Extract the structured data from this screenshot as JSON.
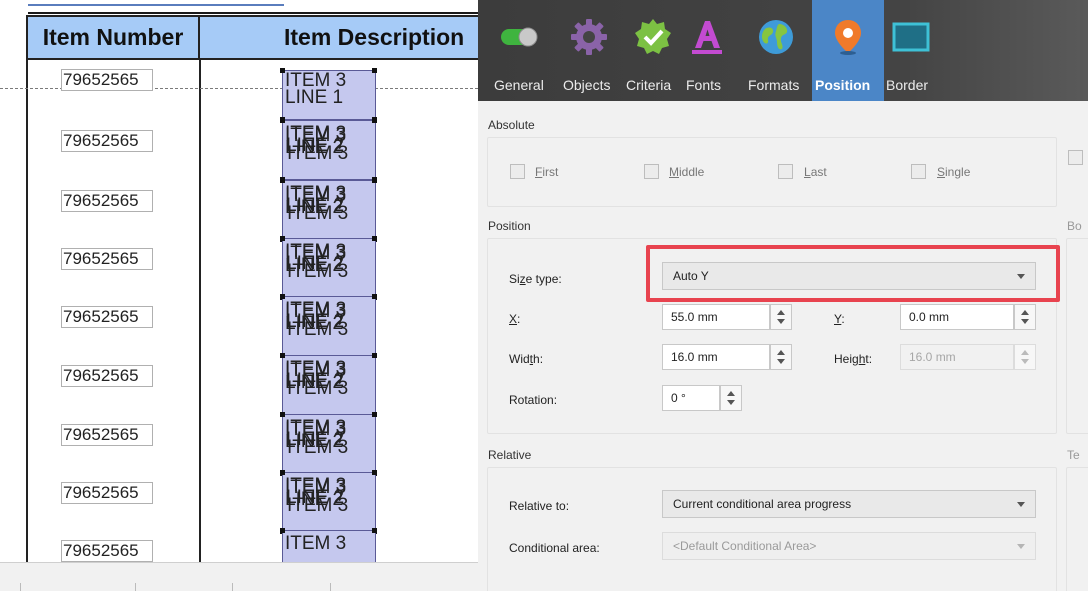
{
  "report": {
    "headers": {
      "item_number": "Item Number",
      "item_description": "Item Description"
    },
    "rows": [
      {
        "item_number": "79652565",
        "description_lines": [
          "ITEM 3",
          "LINE 1"
        ]
      },
      {
        "item_number": "79652565",
        "description_lines": [
          "ITEM 3",
          "LINE 2"
        ]
      },
      {
        "item_number": "79652565",
        "description_lines": [
          "ITEM 3",
          "LINE 2"
        ]
      },
      {
        "item_number": "79652565",
        "description_lines": [
          "ITEM 3",
          "LINE 2"
        ]
      },
      {
        "item_number": "79652565",
        "description_lines": [
          "ITEM 3",
          "LINE 2"
        ]
      },
      {
        "item_number": "79652565",
        "description_lines": [
          "ITEM 3",
          "LINE 2"
        ]
      },
      {
        "item_number": "79652565",
        "description_lines": [
          "ITEM 3",
          "LINE 2"
        ]
      },
      {
        "item_number": "79652565",
        "description_lines": [
          "ITEM 3",
          "LINE 2"
        ]
      },
      {
        "item_number": "79652565",
        "description_lines": [
          "ITEM 3"
        ]
      }
    ]
  },
  "toolbar": {
    "tabs": [
      {
        "label": "General",
        "icon": "toggle-icon"
      },
      {
        "label": "Objects",
        "icon": "gear-icon"
      },
      {
        "label": "Criteria",
        "icon": "badge-check-icon"
      },
      {
        "label": "Fonts",
        "icon": "font-a-icon"
      },
      {
        "label": "Formats",
        "icon": "globe-icon"
      },
      {
        "label": "Position",
        "icon": "map-pin-icon",
        "active": true
      },
      {
        "label": "Border",
        "icon": "border-rectangle-icon"
      }
    ]
  },
  "absolute": {
    "title": "Absolute",
    "checkboxes": [
      {
        "label": "First",
        "accel": "F",
        "rest": "irst",
        "checked": false
      },
      {
        "label": "Middle",
        "accel": "M",
        "rest": "iddle",
        "checked": false
      },
      {
        "label": "Last",
        "accel": "L",
        "rest": "ast",
        "checked": false
      },
      {
        "label": "Single",
        "accel": "S",
        "rest": "ingle",
        "checked": false
      }
    ]
  },
  "position": {
    "title": "Position",
    "size_type_label_a": "Si",
    "size_type_label_u": "z",
    "size_type_label_b": "e type:",
    "size_type_value": "Auto Y",
    "x_label_u": "X",
    "x_label_b": ":",
    "x_value": "55.0 mm",
    "y_label_u": "Y",
    "y_label_b": ":",
    "y_value": "0.0 mm",
    "width_label_a": "Wid",
    "width_label_u": "t",
    "width_label_b": "h:",
    "width_value": "16.0 mm",
    "height_label_a": "Heig",
    "height_label_u": "h",
    "height_label_b": "t:",
    "height_value": "16.0 mm",
    "rotation_label": "Rotation:",
    "rotation_value": "0 °"
  },
  "relative": {
    "title": "Relative",
    "relative_to_label": "Relative to:",
    "relative_to_value": "Current conditional area progress",
    "conditional_area_label": "Conditional area:",
    "conditional_area_value": "<Default Conditional Area>"
  },
  "cut_off": {
    "box_label": "Bo",
    "text_label": "Te"
  },
  "colors": {
    "highlight": "#e8434f",
    "active_tab": "#4b86c7",
    "header_fill": "#a6cbf7",
    "desc_fill": "#c5c8ee"
  }
}
